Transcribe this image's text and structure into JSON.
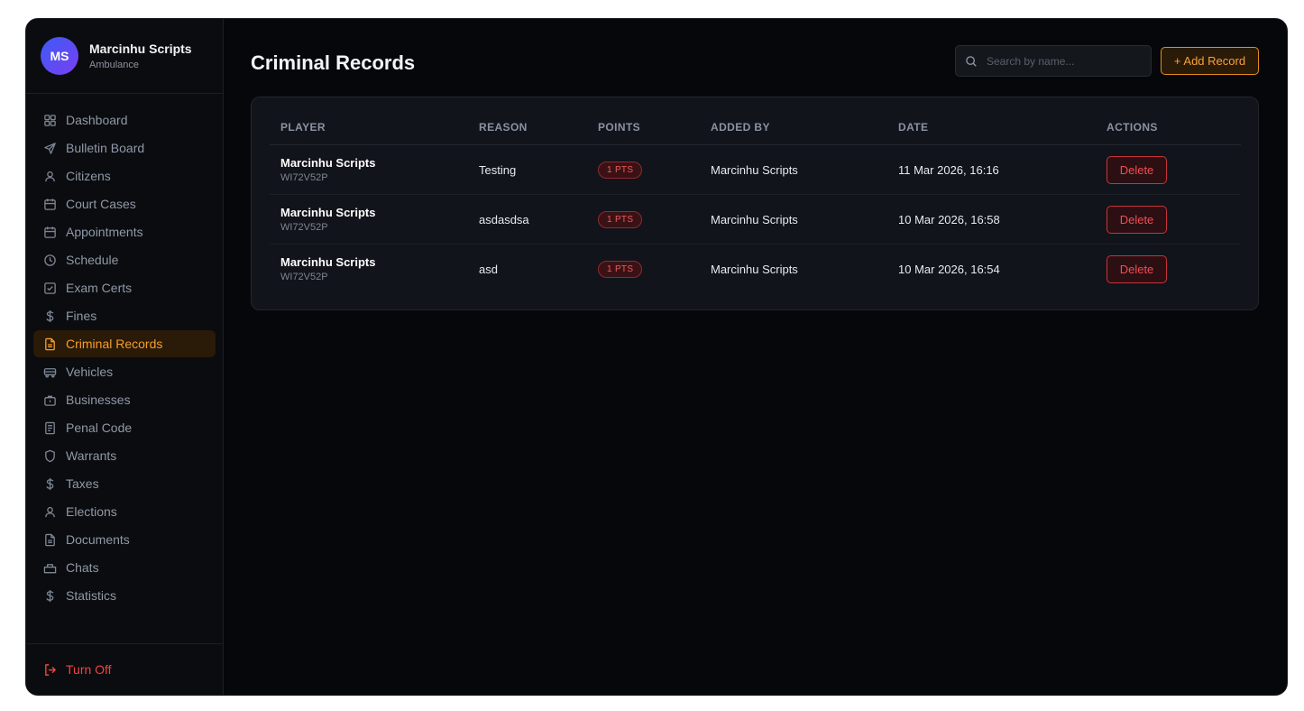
{
  "profile": {
    "initials": "MS",
    "name": "Marcinhu Scripts",
    "role": "Ambulance"
  },
  "sidebar": {
    "items": [
      {
        "label": "Dashboard",
        "icon": "grid-icon"
      },
      {
        "label": "Bulletin Board",
        "icon": "send-icon"
      },
      {
        "label": "Citizens",
        "icon": "user-icon"
      },
      {
        "label": "Court Cases",
        "icon": "calendar-icon"
      },
      {
        "label": "Appointments",
        "icon": "calendar-icon"
      },
      {
        "label": "Schedule",
        "icon": "clock-icon"
      },
      {
        "label": "Exam Certs",
        "icon": "checkbox-icon"
      },
      {
        "label": "Fines",
        "icon": "dollar-icon"
      },
      {
        "label": "Criminal Records",
        "icon": "file-icon",
        "active": true
      },
      {
        "label": "Vehicles",
        "icon": "bus-icon"
      },
      {
        "label": "Businesses",
        "icon": "briefcase-icon"
      },
      {
        "label": "Penal Code",
        "icon": "book-icon"
      },
      {
        "label": "Warrants",
        "icon": "shield-icon"
      },
      {
        "label": "Taxes",
        "icon": "dollar-icon"
      },
      {
        "label": "Elections",
        "icon": "user-icon"
      },
      {
        "label": "Documents",
        "icon": "file-icon"
      },
      {
        "label": "Chats",
        "icon": "chat-icon"
      },
      {
        "label": "Statistics",
        "icon": "dollar-icon"
      }
    ],
    "logout_label": "Turn Off"
  },
  "header": {
    "title": "Criminal Records",
    "search_placeholder": "Search by name...",
    "add_label": "+ Add Record"
  },
  "table": {
    "columns": [
      "PLAYER",
      "REASON",
      "POINTS",
      "ADDED BY",
      "DATE",
      "ACTIONS"
    ],
    "rows": [
      {
        "player": "Marcinhu Scripts",
        "player_id": "WI72V52P",
        "reason": "Testing",
        "points": "1 PTS",
        "added_by": "Marcinhu Scripts",
        "date": "11 Mar 2026, 16:16",
        "action": "Delete"
      },
      {
        "player": "Marcinhu Scripts",
        "player_id": "WI72V52P",
        "reason": "asdasdsa",
        "points": "1 PTS",
        "added_by": "Marcinhu Scripts",
        "date": "10 Mar 2026, 16:58",
        "action": "Delete"
      },
      {
        "player": "Marcinhu Scripts",
        "player_id": "WI72V52P",
        "reason": "asd",
        "points": "1 PTS",
        "added_by": "Marcinhu Scripts",
        "date": "10 Mar 2026, 16:54",
        "action": "Delete"
      }
    ]
  },
  "colors": {
    "accent": "#f59e2a",
    "danger": "#ef4444",
    "background": "#06070a",
    "sidebar": "#0b0c0f",
    "card": "#11141a"
  }
}
